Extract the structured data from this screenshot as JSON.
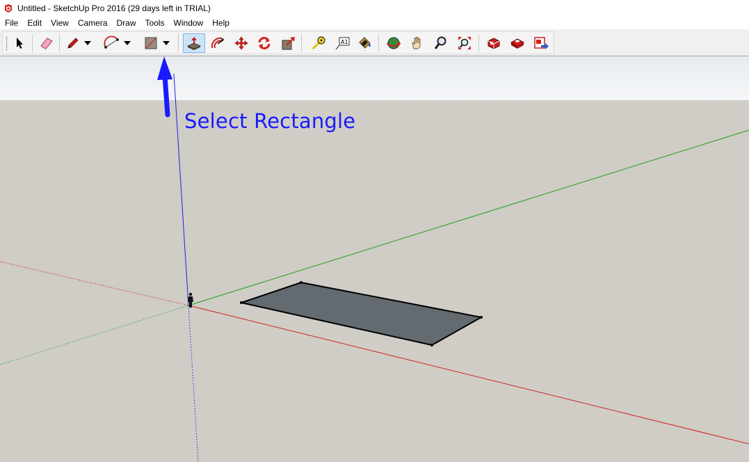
{
  "window": {
    "title": "Untitled - SketchUp Pro 2016 (29 days left in TRIAL)",
    "app_icon": "sketchup-logo-icon"
  },
  "menu": {
    "items": [
      "File",
      "Edit",
      "View",
      "Camera",
      "Draw",
      "Tools",
      "Window",
      "Help"
    ]
  },
  "toolbar": {
    "tools": [
      {
        "name": "select-tool",
        "icon": "arrow-cursor-icon"
      },
      {
        "name": "eraser-tool",
        "icon": "eraser-icon"
      },
      {
        "name": "pencil-tool",
        "icon": "pencil-icon"
      },
      {
        "name": "arc-tool",
        "icon": "arc-icon"
      },
      {
        "name": "rectangle-tool",
        "icon": "rectangle-icon"
      },
      {
        "name": "push-pull-tool",
        "icon": "push-pull-icon",
        "active": true
      },
      {
        "name": "offset-tool",
        "icon": "offset-icon"
      },
      {
        "name": "move-tool",
        "icon": "move-arrows-icon"
      },
      {
        "name": "rotate-tool",
        "icon": "rotate-icon"
      },
      {
        "name": "scale-tool",
        "icon": "scale-icon"
      },
      {
        "name": "tape-measure-tool",
        "icon": "tape-measure-icon"
      },
      {
        "name": "text-tool",
        "icon": "text-label-icon"
      },
      {
        "name": "paint-bucket-tool",
        "icon": "paint-bucket-icon"
      },
      {
        "name": "orbit-tool",
        "icon": "orbit-icon"
      },
      {
        "name": "pan-tool",
        "icon": "hand-icon"
      },
      {
        "name": "zoom-tool",
        "icon": "magnifier-icon"
      },
      {
        "name": "zoom-extents-tool",
        "icon": "zoom-extents-icon"
      },
      {
        "name": "warehouse-tool",
        "icon": "3d-warehouse-icon"
      },
      {
        "name": "extension-warehouse-tool",
        "icon": "extension-warehouse-icon"
      },
      {
        "name": "send-to-layout-tool",
        "icon": "send-to-layout-icon"
      }
    ]
  },
  "annotation": {
    "text": "Select Rectangle",
    "color": "#1a1aff"
  },
  "colors": {
    "viewport_ground": "#cfcdc5",
    "axis_red": "#d42020",
    "axis_green": "#20a020",
    "axis_blue": "#2020e0",
    "rectangle_fill": "#636a70",
    "active_tool_bg": "#cce4f7"
  }
}
